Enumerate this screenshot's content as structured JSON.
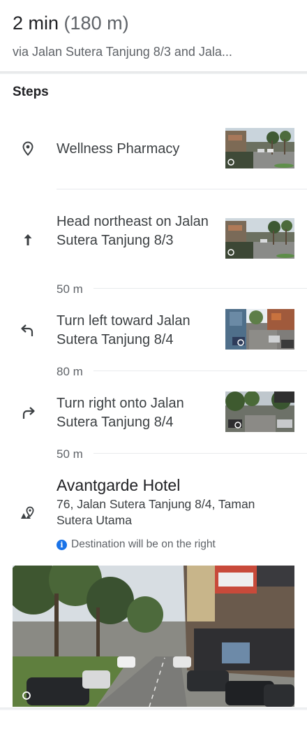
{
  "header": {
    "duration": "2 min",
    "distance": "(180 m)",
    "via": "via Jalan Sutera Tanjung 8/3 and Jala..."
  },
  "steps_title": "Steps",
  "steps": [
    {
      "icon": "location-pin-icon",
      "text": "Wellness Pharmacy"
    },
    {
      "icon": "arrow-up-icon",
      "text": "Head northeast on Jalan Sutera Tanjung 8/3",
      "distance_after": "50 m"
    },
    {
      "icon": "turn-left-icon",
      "text": "Turn left toward Jalan Sutera Tanjung 8/4",
      "distance_after": "80 m"
    },
    {
      "icon": "turn-right-icon",
      "text": "Turn right onto Jalan Sutera Tanjung 8/4",
      "distance_after": "50 m"
    }
  ],
  "destination": {
    "icon": "destination-flag-icon",
    "name": "Avantgarde Hotel",
    "address": "76, Jalan Sutera Tanjung 8/4, Taman Sutera Utama",
    "note": "Destination will be on the right",
    "note_icon": "info-icon"
  },
  "colors": {
    "text_primary": "#202124",
    "text_secondary": "#5f6368",
    "accent_blue": "#1a73e8",
    "divider": "#e8eaed"
  }
}
